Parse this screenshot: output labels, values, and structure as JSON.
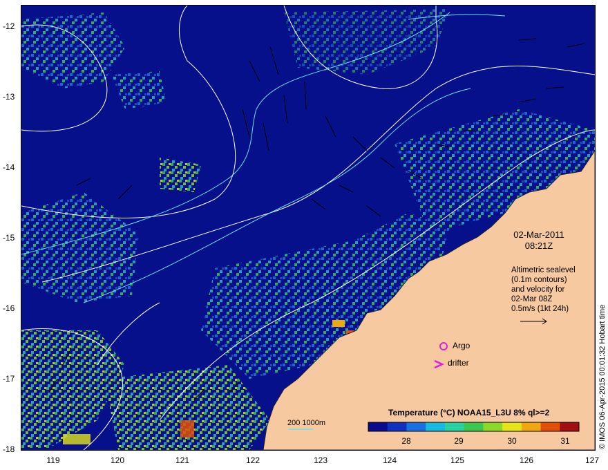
{
  "map": {
    "y_axis_labels": [
      "-12",
      "-13",
      "-14",
      "-15",
      "-16",
      "-17",
      "-18"
    ],
    "x_axis_labels": [
      "119",
      "120",
      "121",
      "122",
      "123",
      "124",
      "125",
      "126",
      "127"
    ],
    "ocean_color": "#06108a",
    "land_color": "#f7c9a0",
    "contour_color": "#ffffff",
    "isobath_color": "#6fe3e8"
  },
  "timestamp": {
    "date": "02-Mar-2011",
    "time": "08:21Z"
  },
  "altimetry": {
    "line1": "Altimetric sealevel",
    "line2": "(0.1m contours)",
    "line3": "and velocity for",
    "line4": "02-Mar 08Z",
    "line5": "0.5m/s (1kt 24h)"
  },
  "legend": {
    "argo_label": "Argo",
    "drifter_label": "drifter",
    "marker_color": "#e020d8",
    "depth_label": "200 1000m"
  },
  "colorbar": {
    "title": "Temperature (°C) NOAA15_L3U 8% ql>=2",
    "tick_labels": [
      "28",
      "29",
      "30",
      "31"
    ],
    "colors": [
      "#0a0a8c",
      "#1030c0",
      "#1a70e0",
      "#19b8e0",
      "#2ad0a0",
      "#3cc850",
      "#8ad82a",
      "#e4e418",
      "#f0a810",
      "#e05008",
      "#a01010"
    ]
  },
  "credit": "© IMOS 06-Apr-2015 00:01:32 Hobart time"
}
